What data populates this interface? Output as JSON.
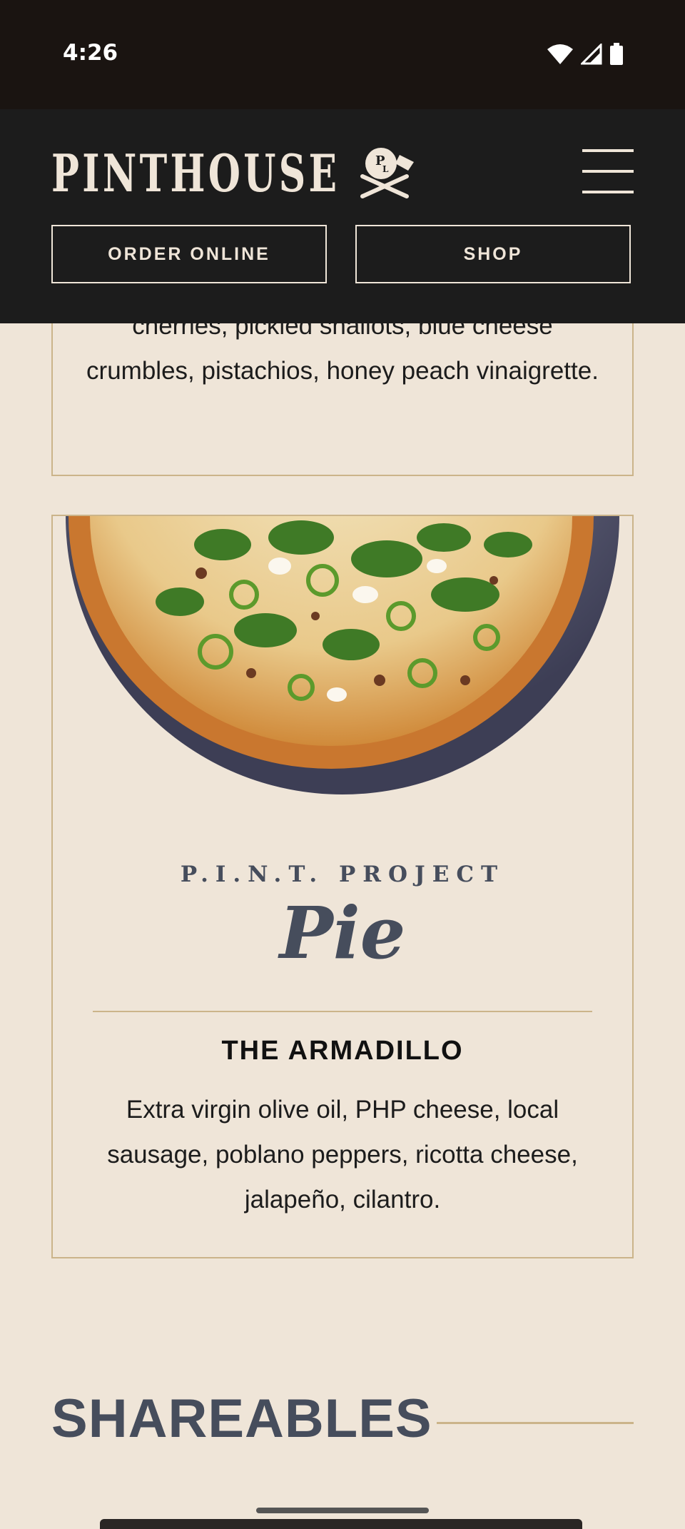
{
  "status_bar": {
    "time": "4:26",
    "icons": [
      "wifi-icon",
      "signal-icon",
      "battery-icon"
    ]
  },
  "header": {
    "logo_text": "PINTHOUSE",
    "logo_badge": "P L",
    "menu_icon": "hamburger-menu-icon",
    "buttons": {
      "order_online": "ORDER ONLINE",
      "shop": "SHOP"
    }
  },
  "previous_item": {
    "description": "cherries, pickled shallots, blue cheese crumbles, pistachios, honey peach vinaigrette."
  },
  "pie_card": {
    "series": "P.I.N.T. PROJECT",
    "category": "Pie",
    "item_name": "THE ARMADILLO",
    "description": "Extra virgin olive oil, PHP cheese, local sausage, poblano peppers, ricotta cheese, jalapeño, cilantro."
  },
  "section": {
    "title": "SHAREABLES"
  },
  "colors": {
    "background": "#efe5d8",
    "header": "#1c1c1c",
    "accent_gold": "#cbb48a",
    "slate": "#464d5c"
  }
}
